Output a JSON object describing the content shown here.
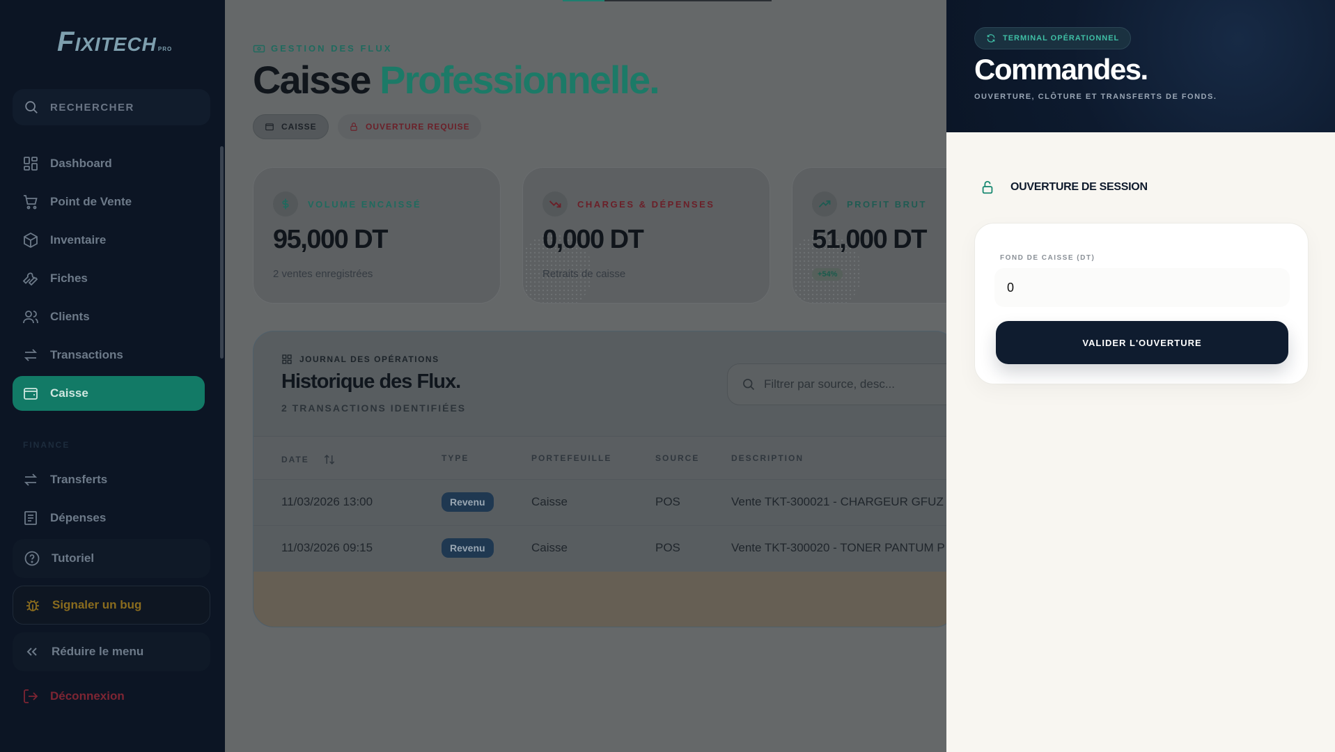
{
  "sidebar": {
    "logo": {
      "first": "F",
      "rest": "IXITECH",
      "sub": "PRO"
    },
    "search_label": "RECHERCHER",
    "items": [
      {
        "label": "Dashboard",
        "icon": "grid-icon"
      },
      {
        "label": "Point de Vente",
        "icon": "cart-icon"
      },
      {
        "label": "Inventaire",
        "icon": "box-icon"
      },
      {
        "label": "Fiches",
        "icon": "wrench-icon"
      },
      {
        "label": "Clients",
        "icon": "users-icon"
      },
      {
        "label": "Transactions",
        "icon": "arrows-icon"
      },
      {
        "label": "Caisse",
        "icon": "wallet-icon",
        "active": true
      }
    ],
    "section_finance": "FINANCE",
    "finance_items": [
      {
        "label": "Transferts",
        "icon": "arrows-icon"
      },
      {
        "label": "Dépenses",
        "icon": "receipt-icon"
      }
    ],
    "tutorial_label": "Tutoriel",
    "bug_label": "Signaler un bug",
    "collapse_label": "Réduire le menu",
    "logout_label": "Déconnexion"
  },
  "main": {
    "eyebrow": "GESTION DES FLUX",
    "title_part1": "Caisse",
    "title_part2": "Professionnelle.",
    "chip_caisse": "CAISSE",
    "chip_required": "OUVERTURE REQUISE",
    "stats": [
      {
        "label": "VOLUME ENCAISSÉ",
        "value": "95,000 DT",
        "foot": "2 ventes enregistrées",
        "icon": "dollar-icon",
        "color": "#1f6a5e"
      },
      {
        "label": "CHARGES & DÉPENSES",
        "value": "0,000 DT",
        "foot": "Retraits de caisse",
        "icon": "trend-down-icon",
        "color": "#6b1f28"
      },
      {
        "label": "PROFIT BRUT",
        "value": "51,000 DT",
        "badge": "+54%",
        "icon": "trend-up-icon",
        "color": "#1f5b52"
      }
    ],
    "journal": {
      "eyebrow": "JOURNAL DES OPÉRATIONS",
      "title": "Historique des Flux.",
      "subtitle": "2 TRANSACTIONS IDENTIFIÉES",
      "filter_placeholder": "Filtrer par source, desc...",
      "columns": [
        "DATE",
        "TYPE",
        "PORTEFEUILLE",
        "SOURCE",
        "DESCRIPTION"
      ],
      "rows": [
        {
          "date": "11/03/2026 13:00",
          "type": "Revenu",
          "wallet": "Caisse",
          "source": "POS",
          "description": "Vente TKT-300021 - CHARGEUR GFUZ"
        },
        {
          "date": "11/03/2026 09:15",
          "type": "Revenu",
          "wallet": "Caisse",
          "source": "POS",
          "description": "Vente TKT-300020 - TONER PANTUM P"
        }
      ]
    }
  },
  "panel": {
    "badge": "TERMINAL OPÉRATIONNEL",
    "title": "Commandes.",
    "subtitle": "OUVERTURE, CLÔTURE ET TRANSFERTS DE FONDS.",
    "session_label": "OUVERTURE DE SESSION",
    "fund_label": "FOND DE CAISSE (DT)",
    "fund_value": "0",
    "validate_label": "VALIDER L'OUVERTURE"
  }
}
